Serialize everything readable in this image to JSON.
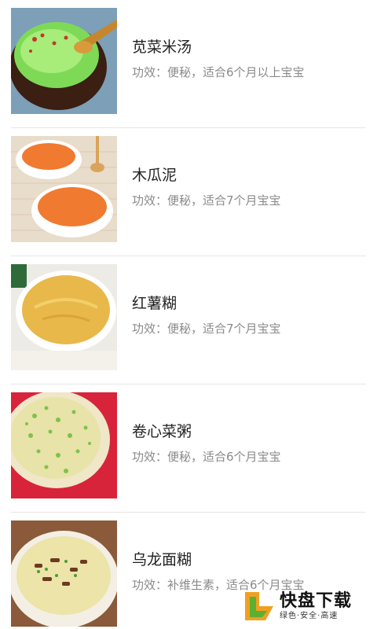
{
  "recipes": [
    {
      "title": "苋菜米汤",
      "desc": "功效：便秘，适合6个月以上宝宝",
      "thumb_icon": "green-porridge-photo"
    },
    {
      "title": "木瓜泥",
      "desc": "功效：便秘，适合7个月宝宝",
      "thumb_icon": "papaya-puree-photo"
    },
    {
      "title": "红薯糊",
      "desc": "功效：便秘，适合7个月宝宝",
      "thumb_icon": "sweet-potato-paste-photo"
    },
    {
      "title": "卷心菜粥",
      "desc": "功效：便秘，适合6个月宝宝",
      "thumb_icon": "cabbage-porridge-photo"
    },
    {
      "title": "乌龙面糊",
      "desc": "功效：补维生素，适合6个月宝宝",
      "thumb_icon": "noodle-paste-photo"
    }
  ],
  "watermark": {
    "name": "快盘下载",
    "sub": "绿色·安全·高速",
    "logo_icon": "kuaipan-logo-icon",
    "accent": "#f0a020"
  }
}
